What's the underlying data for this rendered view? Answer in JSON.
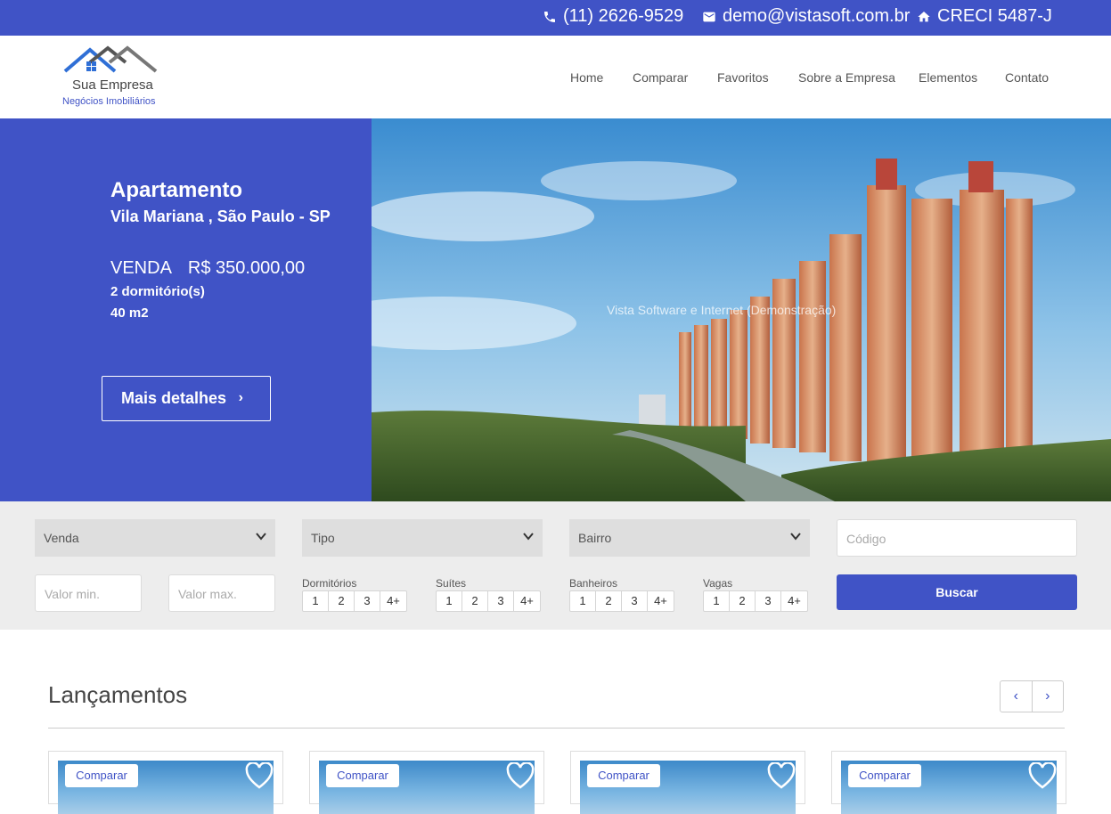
{
  "topbar": {
    "phone": "(11) 2626-9529",
    "email": "demo@vistasoft.com.br",
    "creci": "CRECI 5487-J"
  },
  "logo": {
    "name": "Sua Empresa",
    "tagline": "Negócios Imobiliários"
  },
  "nav": [
    "Home",
    "Comparar",
    "Favoritos",
    "Sobre a Empresa",
    "Elementos",
    "Contato"
  ],
  "hero": {
    "type": "Apartamento",
    "location": "Vila Mariana , São Paulo - SP",
    "deal": "VENDA",
    "price": "R$ 350.000,00",
    "bedrooms": "2 dormitório(s)",
    "area": "40 m2",
    "button": "Mais detalhes",
    "watermark": "Vista Software e Internet (Demonstração)"
  },
  "search": {
    "finalidade": "Venda",
    "tipo": "Tipo",
    "bairro": "Bairro",
    "codigo_placeholder": "Código",
    "valor_min_placeholder": "Valor min.",
    "valor_max_placeholder": "Valor max.",
    "groups": [
      {
        "label": "Dormitórios",
        "options": [
          "1",
          "2",
          "3",
          "4+"
        ]
      },
      {
        "label": "Suítes",
        "options": [
          "1",
          "2",
          "3",
          "4+"
        ]
      },
      {
        "label": "Banheiros",
        "options": [
          "1",
          "2",
          "3",
          "4+"
        ]
      },
      {
        "label": "Vagas",
        "options": [
          "1",
          "2",
          "3",
          "4+"
        ]
      }
    ],
    "button": "Buscar"
  },
  "section": {
    "title": "Lançamentos",
    "prev": "‹",
    "next": "›"
  },
  "cards": [
    {
      "compare": "Comparar"
    },
    {
      "compare": "Comparar"
    },
    {
      "compare": "Comparar"
    },
    {
      "compare": "Comparar"
    }
  ],
  "colors": {
    "primary": "#4053c6",
    "search_bg": "#ededed"
  }
}
